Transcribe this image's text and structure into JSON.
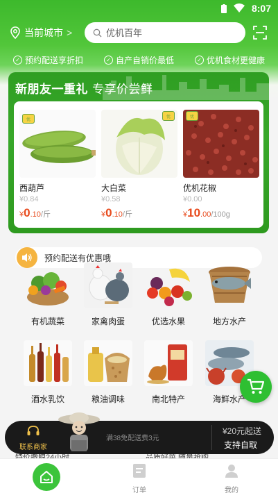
{
  "status_bar": {
    "time": "8:07"
  },
  "header": {
    "city_label": "当前城市",
    "city_chevron": ">",
    "search_placeholder": "优机百年",
    "perks": [
      "预约配送享折扣",
      "自产自销价最低",
      "优机食材更健康"
    ]
  },
  "promo": {
    "title": "新朋友一重礼",
    "subtitle": "专享价尝鲜",
    "products": [
      {
        "name": "西葫芦",
        "orig_price": "¥0.84",
        "currency": "¥",
        "price_int": "0",
        "price_dec": ".10",
        "unit": "/斤"
      },
      {
        "name": "大白菜",
        "orig_price": "¥0.58",
        "currency": "¥",
        "price_int": "0",
        "price_dec": ".10",
        "unit": "/斤"
      },
      {
        "name": "优机花椒",
        "orig_price": "¥0.00",
        "currency": "¥",
        "price_int": "10",
        "price_dec": ".00",
        "unit": "/100g"
      }
    ]
  },
  "notice": {
    "text": "预约配送有优惠哦"
  },
  "categories": [
    {
      "label": "有机蔬菜"
    },
    {
      "label": "家禽肉蛋"
    },
    {
      "label": "优选水果"
    },
    {
      "label": "地方水产"
    },
    {
      "label": "酒水乳饮"
    },
    {
      "label": "粮油调味"
    },
    {
      "label": "南北特产"
    },
    {
      "label": "海鲜水产"
    }
  ],
  "cart_bar": {
    "contact_label": "联系商家",
    "free_shipping": "满38免配送费3元",
    "min_order": "¥20元起送",
    "pickup": "支持自取"
  },
  "peek_text": {
    "left": "特价撤粮24小时",
    "right": "品质好菜 随量抢购"
  },
  "tabbar": {
    "tabs": [
      {
        "label": ""
      },
      {
        "label": "订单"
      },
      {
        "label": "我的"
      }
    ]
  },
  "colors": {
    "brand_green": "#3db92c",
    "price_red": "#e84a1c",
    "cart_bar": "#1a1a1a",
    "fab_green": "#2ebf32"
  }
}
